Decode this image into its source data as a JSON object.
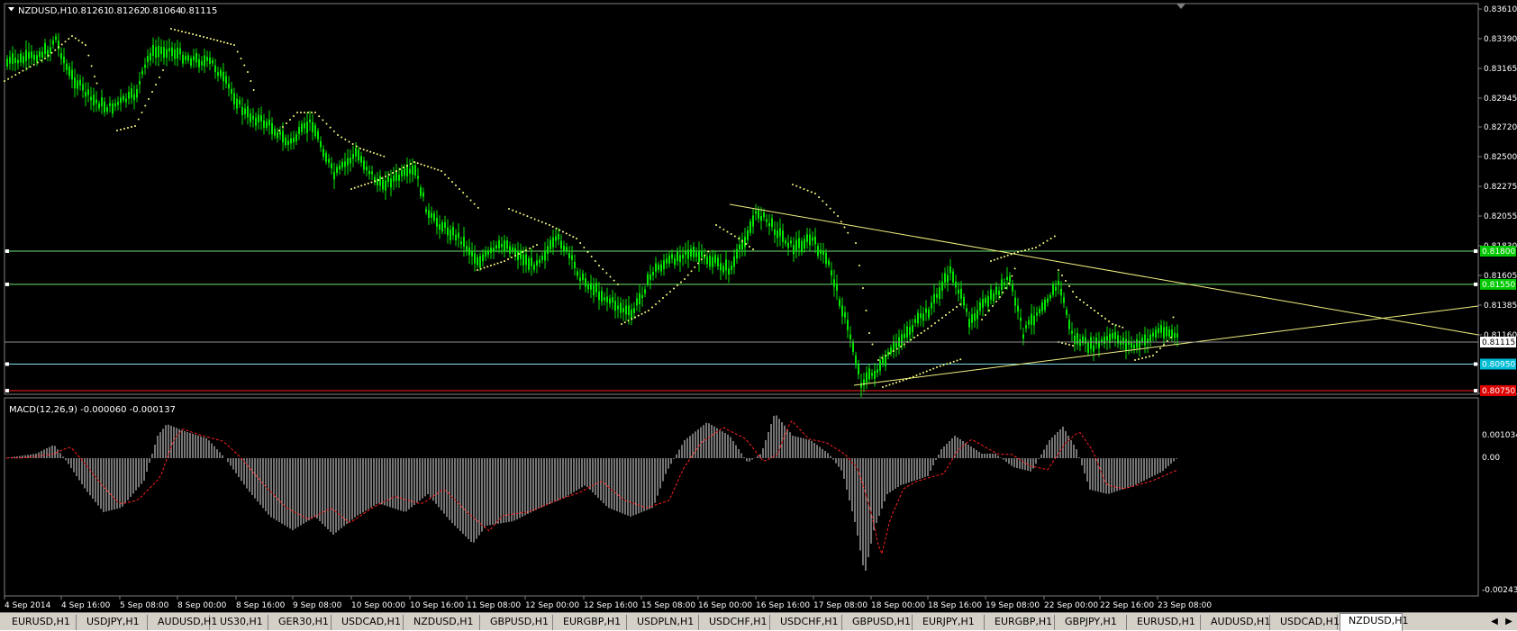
{
  "chart": {
    "symbol": "NZDUSD,H1",
    "quote_open": "0.81261",
    "quote_high": "0.81262",
    "quote_low": "0.81064",
    "quote_close": "0.81115",
    "price_axis": [
      "0.83610",
      "0.83390",
      "0.83165",
      "0.82945",
      "0.82720",
      "0.82500",
      "0.82275",
      "0.82055",
      "0.81830",
      "0.81605",
      "0.81385",
      "0.81160",
      "0.80715"
    ],
    "current_price": "0.81115",
    "levels": [
      {
        "label": "0.81800",
        "color": "#00c800",
        "line": "#6ee26e",
        "price": 0.818
      },
      {
        "label": "0.81550",
        "color": "#00c800",
        "line": "#6ee26e",
        "price": 0.8155
      },
      {
        "label": "0.80950",
        "color": "#00bcd4",
        "line": "#7fe0ea",
        "price": 0.8095
      },
      {
        "label": "0.80750",
        "color": "#dd0000",
        "line": "#ff2020",
        "price": 0.8075
      }
    ],
    "time_axis": [
      "4 Sep 2014",
      "4 Sep 16:00",
      "5 Sep 08:00",
      "8 Sep 00:00",
      "8 Sep 16:00",
      "9 Sep 08:00",
      "10 Sep 00:00",
      "10 Sep 16:00",
      "11 Sep 08:00",
      "12 Sep 00:00",
      "12 Sep 16:00",
      "15 Sep 08:00",
      "16 Sep 00:00",
      "16 Sep 16:00",
      "17 Sep 08:00",
      "18 Sep 00:00",
      "18 Sep 16:00",
      "19 Sep 08:00",
      "22 Sep 00:00",
      "22 Sep 16:00",
      "23 Sep 08:00"
    ],
    "colors": {
      "bull": "#00e600",
      "wick": "#00e600",
      "sar": "#ffff80",
      "trend": "#f0f080",
      "macd_hist": "#e8e8e8",
      "macd_signal": "#ff2020",
      "grid": "#808080"
    }
  },
  "macd": {
    "label": "MACD(12,26,9) -0.000060 -0.000137",
    "axis": [
      "0.001034",
      "0.00",
      "-0.002433"
    ]
  },
  "tabs": [
    "EURUSD,H1",
    "USDJPY,H1",
    "AUDUSD,H1",
    "US30,H1",
    "GER30,H1",
    "USDCAD,H1",
    "NZDUSD,H1",
    "GBPUSD,H1",
    "EURGBP,H1",
    "USDPLN,H1",
    "USDCHF,H1",
    "USDCHF,H1",
    "GBPUSD,H1",
    "EURJPY,H1",
    "EURGBP,H1",
    "GBPJPY,H1",
    "EURUSD,H1",
    "AUDUSD,H1",
    "USDCAD,H1",
    "NZDUSD,H1"
  ],
  "active_tab": 19,
  "icons": {
    "chart_menu": "triangle-down-icon",
    "shift_marker": "triangle-marker-icon",
    "scroll_left": "arrow-left-icon",
    "scroll_right": "arrow-right-icon"
  }
}
